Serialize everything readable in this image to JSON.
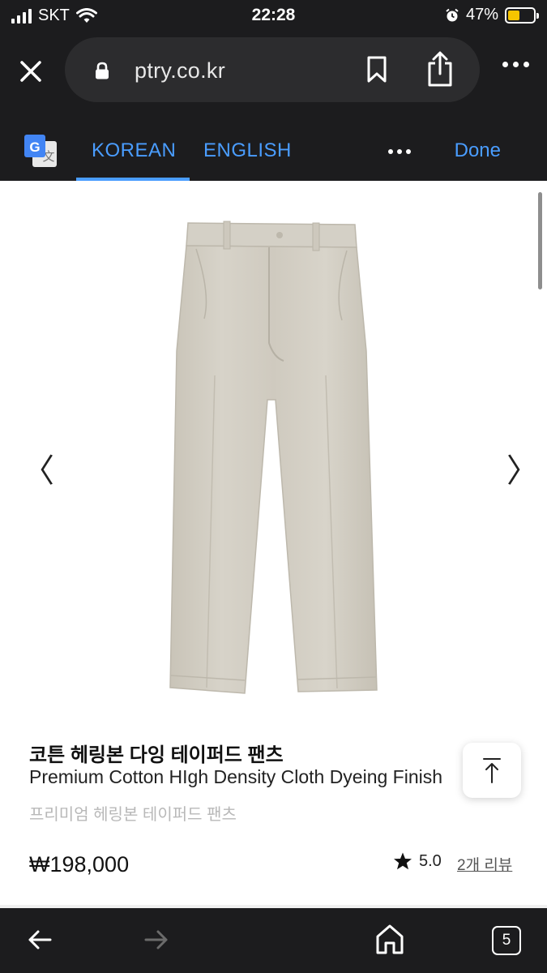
{
  "status_bar": {
    "carrier": "SKT",
    "time": "22:28",
    "battery_percent": "47%",
    "battery_level": 0.47,
    "battery_color": "#f5c400"
  },
  "browser": {
    "url": "ptry.co.kr",
    "icons": [
      "close-icon",
      "lock-icon",
      "bookmark-icon",
      "share-icon",
      "more-icon"
    ]
  },
  "translate_bar": {
    "tabs": [
      {
        "label": "KOREAN",
        "active": true
      },
      {
        "label": "ENGLISH",
        "active": false
      }
    ],
    "done_label": "Done",
    "accent_color": "#4a9dff"
  },
  "product": {
    "title_ko": "코튼 헤링본 다잉 테이퍼드 팬츠",
    "title_en": "Premium Cotton HIgh Density Cloth Dyeing Finish",
    "subtitle": "프리미엄 헤링본 테이퍼드 팬츠",
    "price": "₩198,000",
    "rating": "5.0",
    "review_link": "2개 리뷰",
    "gallery_prev": "〈",
    "gallery_next": "〉"
  },
  "bottom_toolbar": {
    "tab_count": "5",
    "icons": [
      "back-arrow-icon",
      "forward-arrow-icon",
      "home-icon",
      "tabs-icon"
    ]
  }
}
